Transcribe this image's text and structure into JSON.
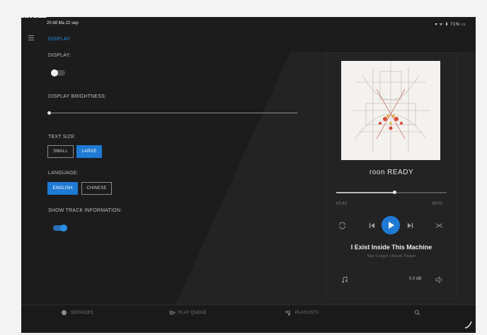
{
  "watermark": "hifi.nl",
  "status_bar": {
    "time": "20:48 Ma 22 sep",
    "indicators": "▾ ᯤ ⬇ 71% ▭"
  },
  "header": {
    "title": "DISPLAY"
  },
  "settings": {
    "display_label": "DISPLAY:",
    "display_on": false,
    "brightness_label": "DISPLAY BRIGHTNESS:",
    "brightness_value": 0,
    "text_size_label": "TEXT SIZE:",
    "text_size_options": [
      "SMALL",
      "LARGE"
    ],
    "text_size_selected": "LARGE",
    "language_label": "LANGUAGE:",
    "language_options": [
      "ENGLISH",
      "CHINESE"
    ],
    "language_selected": "ENGLISH",
    "track_info_label": "SHOW TRACK INFORMATION:",
    "track_info_on": true
  },
  "player": {
    "brand": "roon READY",
    "elapsed": "03:42",
    "duration": "06:02",
    "progress": 0.53,
    "title": "I Exist Inside This Machine",
    "artist": "Max Cooper | Aneek Thapar",
    "volume": "0.0 dB"
  },
  "bottom_nav": {
    "services": "SERVICES",
    "play_queue": "PLAY QUEUE",
    "playlists": "PLAYLISTS"
  },
  "colors": {
    "accent": "#1f7ad4",
    "background": "#1c1c1d"
  }
}
